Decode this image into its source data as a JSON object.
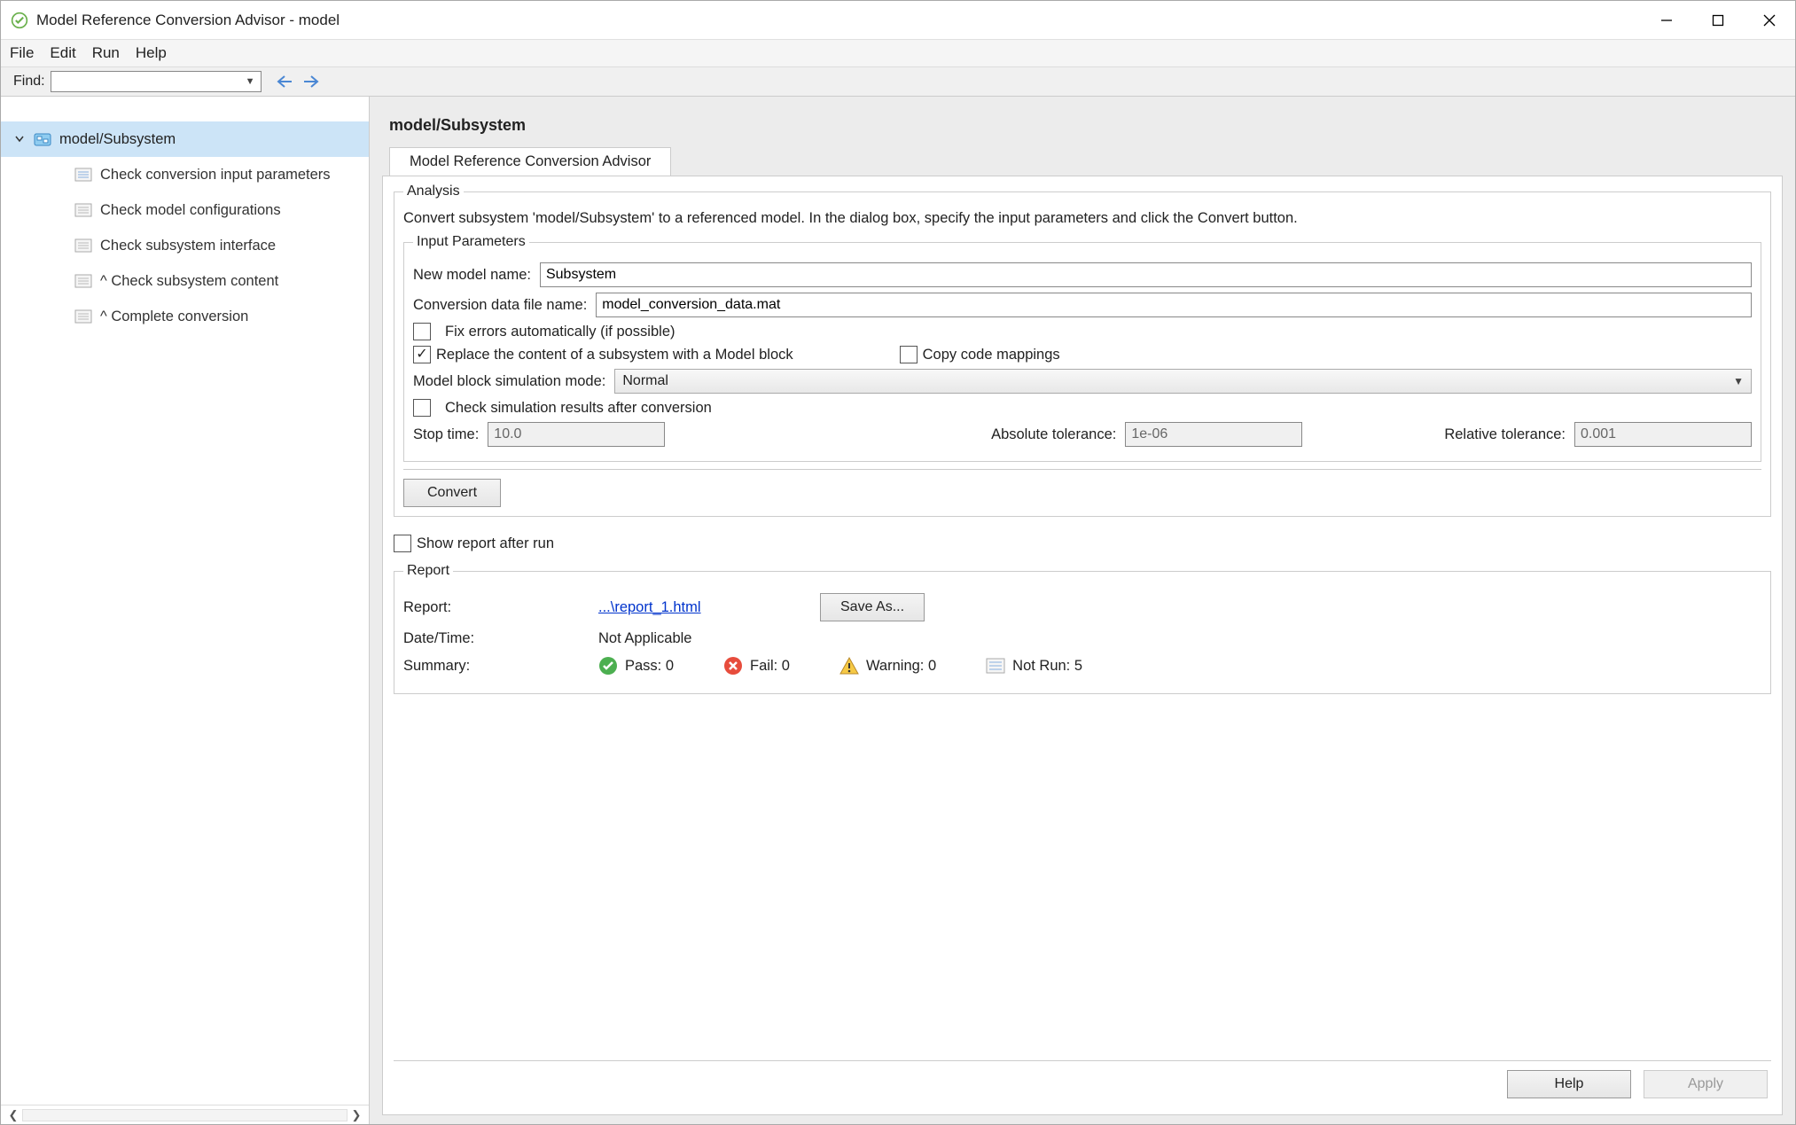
{
  "window": {
    "title": "Model Reference Conversion Advisor - model"
  },
  "menu": {
    "file": "File",
    "edit": "Edit",
    "run": "Run",
    "help": "Help"
  },
  "find": {
    "label": "Find:"
  },
  "tree": {
    "root": "model/Subsystem",
    "items": [
      "Check conversion input parameters",
      "Check model configurations",
      "Check subsystem interface",
      "^ Check subsystem content",
      "^ Complete conversion"
    ]
  },
  "content": {
    "heading": "model/Subsystem",
    "tab": "Model Reference Conversion Advisor",
    "analysis_legend": "Analysis",
    "desc": "Convert subsystem 'model/Subsystem' to a referenced model. In the dialog box, specify the input parameters and click the Convert button.",
    "input_legend": "Input Parameters",
    "new_model_label": "New model name:",
    "new_model_value": "Subsystem",
    "conv_file_label": "Conversion data file name:",
    "conv_file_value": "model_conversion_data.mat",
    "fix_errors": "Fix errors automatically (if possible)",
    "replace_content": "Replace the content of a subsystem with a Model block",
    "copy_mappings": "Copy code mappings",
    "sim_mode_label": "Model block simulation mode:",
    "sim_mode_value": "Normal",
    "check_sim": "Check simulation results after conversion",
    "stop_time_label": "Stop time:",
    "stop_time_value": "10.0",
    "abs_tol_label": "Absolute tolerance:",
    "abs_tol_value": "1e-06",
    "rel_tol_label": "Relative tolerance:",
    "rel_tol_value": "0.001",
    "convert_btn": "Convert",
    "show_report": "Show report after run",
    "report_legend": "Report",
    "report_label": "Report:",
    "report_link": "...\\report_1.html",
    "save_as_btn": "Save As...",
    "datetime_label": "Date/Time:",
    "datetime_value": "Not Applicable",
    "summary_label": "Summary:",
    "pass": "Pass: 0",
    "fail": "Fail: 0",
    "warning": "Warning: 0",
    "notrun": "Not Run: 5",
    "help_btn": "Help",
    "apply_btn": "Apply"
  }
}
